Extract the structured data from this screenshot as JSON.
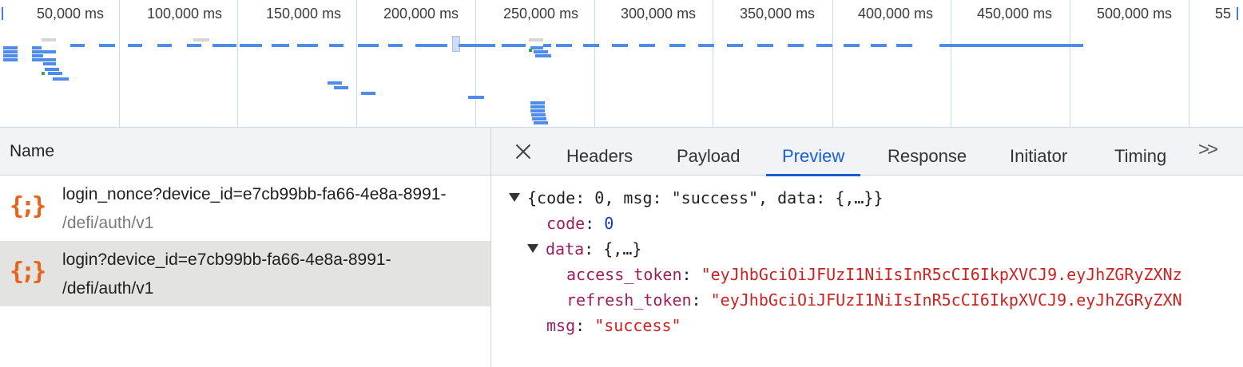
{
  "overview": {
    "ticks": [
      "50,000 ms",
      "100,000 ms",
      "150,000 ms",
      "200,000 ms",
      "250,000 ms",
      "300,000 ms",
      "350,000 ms",
      "400,000 ms",
      "450,000 ms",
      "500,000 ms",
      "55"
    ]
  },
  "requests": {
    "header": "Name",
    "items": [
      {
        "icon": "{;}",
        "name": "login_nonce?device_id=e7cb99bb-fa66-4e8a-8991-",
        "path": "/defi/auth/v1"
      },
      {
        "icon": "{;}",
        "name": "login?device_id=e7cb99bb-fa66-4e8a-8991-",
        "path": "/defi/auth/v1"
      }
    ]
  },
  "tabs": {
    "headers": "Headers",
    "payload": "Payload",
    "preview": "Preview",
    "response": "Response",
    "initiator": "Initiator",
    "timing": "Timing",
    "more": ">>"
  },
  "preview": {
    "summary": "{code: 0, msg: \"success\", data: {,…}}",
    "code_key": "code",
    "code_val": "0",
    "data_key": "data",
    "data_summary": "{,…}",
    "access_token_key": "access_token",
    "access_token_val": "\"eyJhbGciOiJFUzI1NiIsInR5cCI6IkpXVCJ9.eyJhZGRyZXNz",
    "refresh_token_key": "refresh_token",
    "refresh_token_val": "\"eyJhbGciOiJFUzI1NiIsInR5cCI6IkpXVCJ9.eyJhZGRyZXN",
    "msg_key": "msg",
    "msg_val": "\"success\""
  }
}
